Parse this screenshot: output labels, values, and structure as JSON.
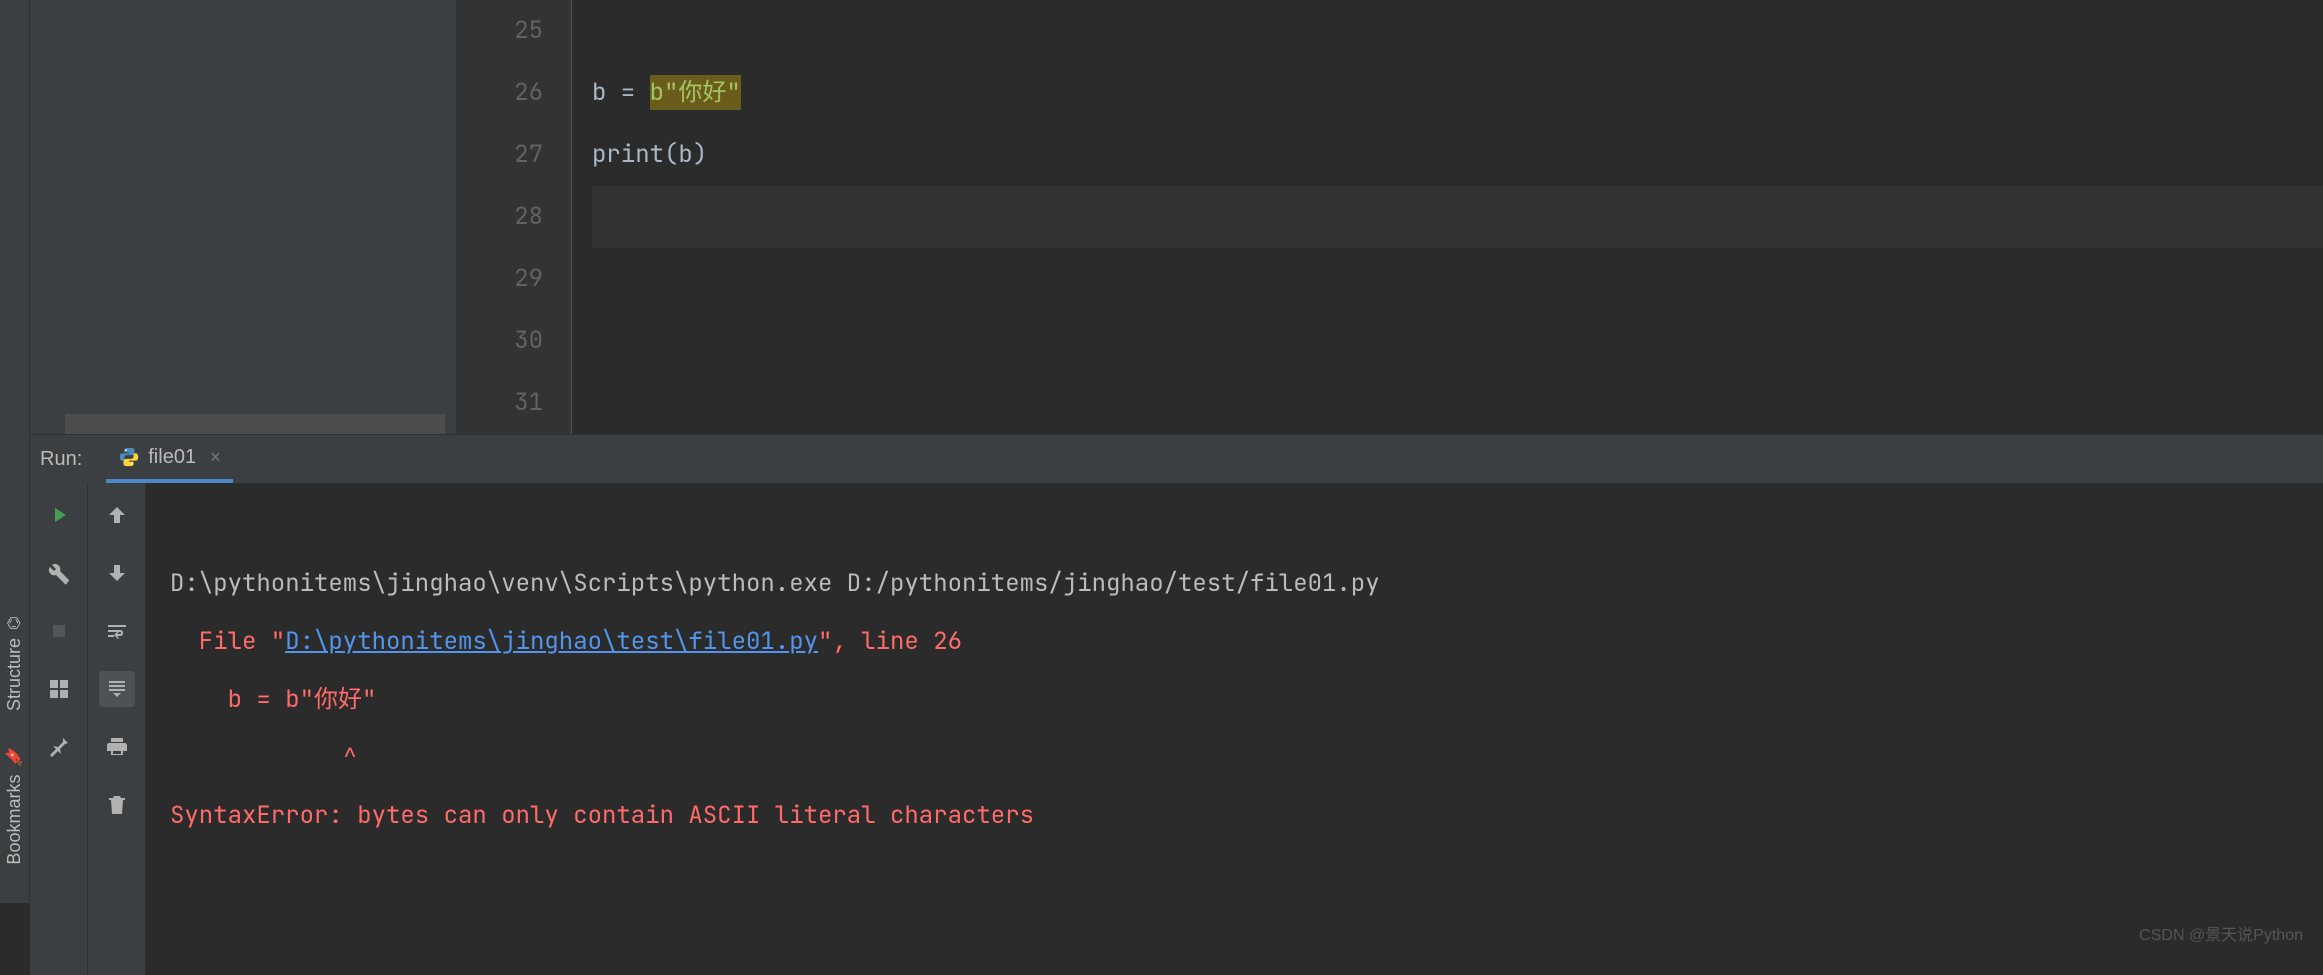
{
  "rail": {
    "structure_label": "Structure",
    "bookmarks_label": "Bookmarks"
  },
  "editor": {
    "lines": {
      "25": "25",
      "26": "26",
      "27": "27",
      "28": "28",
      "29": "29",
      "30": "30",
      "31": "31"
    },
    "line26": {
      "var": "b",
      "eq": " = ",
      "prefix": "b",
      "quote_open": "\"",
      "content": "你好",
      "quote_close": "\""
    },
    "line27": {
      "fn": "print",
      "open": "(",
      "arg": "b",
      "close": ")"
    }
  },
  "run": {
    "label": "Run:",
    "tab_name": "file01",
    "output": {
      "cmd": "D:\\pythonitems\\jinghao\\venv\\Scripts\\python.exe D:/pythonitems/jinghao/test/file01.py",
      "file_prefix": "  File \"",
      "file_link": "D:\\pythonitems\\jinghao\\test\\file01.py",
      "file_suffix": "\", line 26",
      "code_line": "    b = b\"你好\"",
      "caret_line": "            ^",
      "error_line": "SyntaxError: bytes can only contain ASCII literal characters"
    }
  },
  "watermark": "CSDN @景天说Python"
}
